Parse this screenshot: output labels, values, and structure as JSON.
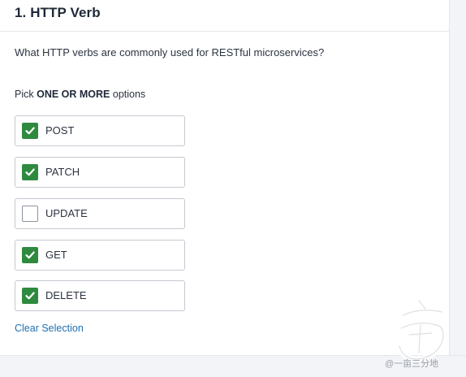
{
  "question": {
    "title": "1. HTTP Verb",
    "text": "What HTTP verbs are commonly used for RESTful microservices?",
    "instruction_prefix": "Pick ",
    "instruction_bold": "ONE OR MORE",
    "instruction_suffix": " options"
  },
  "options": [
    {
      "label": "POST",
      "checked": true
    },
    {
      "label": "PATCH",
      "checked": true
    },
    {
      "label": "UPDATE",
      "checked": false
    },
    {
      "label": "GET",
      "checked": true
    },
    {
      "label": "DELETE",
      "checked": true
    }
  ],
  "clear_selection_label": "Clear Selection",
  "watermark": {
    "text": "@一亩三分地",
    "icon": "watermark-logo-icon"
  },
  "colors": {
    "checked": "#2f8a3f",
    "link": "#1f6fb2"
  }
}
